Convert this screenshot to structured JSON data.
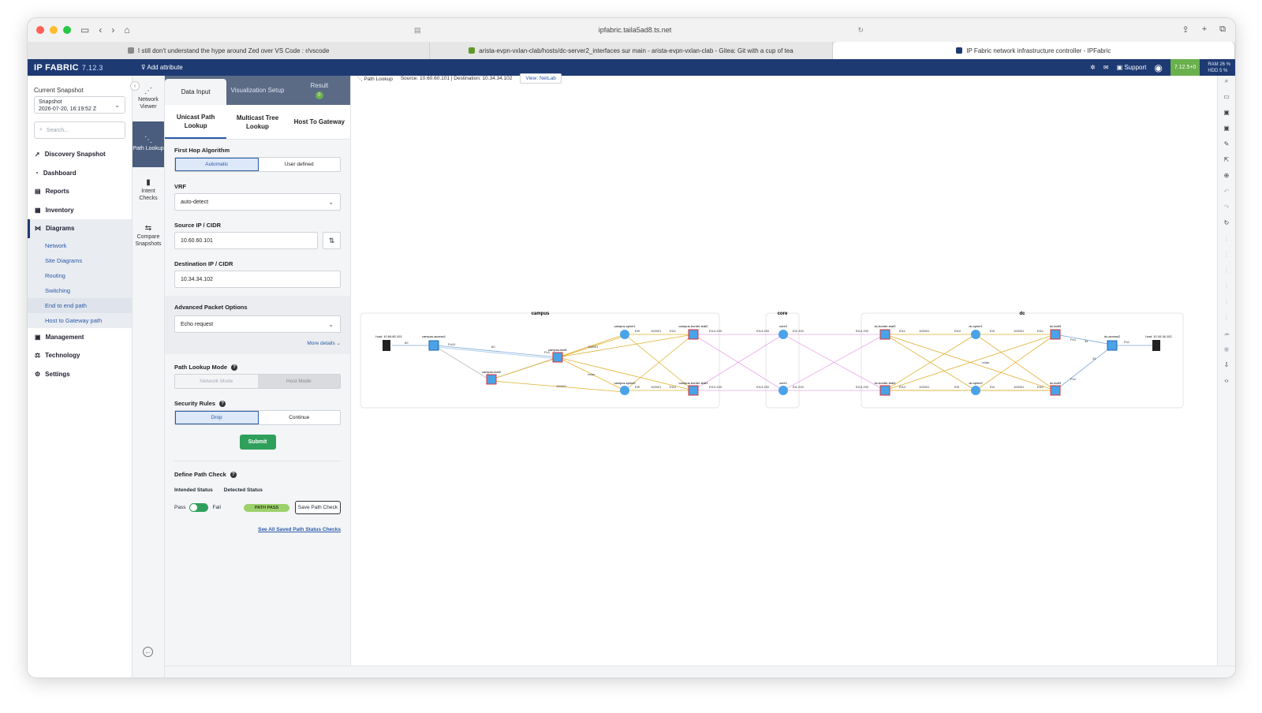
{
  "browser": {
    "url": "ipfabric.taila5ad8.ts.net",
    "tabs": [
      {
        "label": "I still don't understand the hype around Zed over VS Code : r/vscode",
        "fav_color": "#8a8a8a",
        "active": false
      },
      {
        "label": "arista-evpn-vxlan-clab/hosts/dc-server2_interfaces sur main - arista-evpn-vxlan-clab - Gitea: Git with a cup of tea",
        "fav_color": "#609926",
        "active": false
      },
      {
        "label": "IP Fabric network infrastructure controller - IPFabric",
        "fav_color": "#1d3a73",
        "active": true
      }
    ]
  },
  "header": {
    "logo": "IP FABRIC",
    "version": "7.12.3",
    "add_attribute": "Add attribute",
    "support": "Support",
    "version_badge": "7.12.5+0",
    "ram": "RAM 26 %",
    "hdd": "HDD 5 %"
  },
  "leftnav": {
    "snapshot_label": "Current Snapshot",
    "snapshot_name": "Snapshot",
    "snapshot_date": "2026-07-20, 16:19:52 Z",
    "search_placeholder": "Search...",
    "items": [
      {
        "label": "Discovery Snapshot",
        "icon": "rocket-icon"
      },
      {
        "label": "Dashboard",
        "icon": "dashboard-icon"
      },
      {
        "label": "Reports",
        "icon": "report-icon"
      },
      {
        "label": "Inventory",
        "icon": "inventory-icon"
      },
      {
        "label": "Diagrams",
        "icon": "diagram-icon"
      }
    ],
    "diagram_subs": [
      "Network",
      "Site Diagrams",
      "Routing",
      "Switching",
      "End to end path",
      "Host to Gateway path"
    ],
    "items_bottom": [
      {
        "label": "Management",
        "icon": "management-icon"
      },
      {
        "label": "Technology",
        "icon": "technology-icon"
      },
      {
        "label": "Settings",
        "icon": "settings-icon"
      }
    ]
  },
  "rail": {
    "network_viewer": "Network Viewer",
    "path_lookup": "Path Lookup",
    "intent_checks": "Intent Checks",
    "compare_snapshots": "Compare Snapshots"
  },
  "panel": {
    "tabs": [
      "Data Input",
      "Visualization Setup",
      "Result"
    ],
    "result_count": "0",
    "subtabs": [
      "Unicast Path Lookup",
      "Multicast Tree Lookup",
      "Host To Gateway"
    ],
    "first_hop_label": "First Hop Algorithm",
    "first_hop_options": [
      "Automatic",
      "User defined"
    ],
    "vrf_label": "VRF",
    "vrf_value": "auto-detect",
    "source_label": "Source IP / CIDR",
    "source_value": "10.60.60.101",
    "dest_label": "Destination IP / CIDR",
    "dest_value": "10.34.34.102",
    "adv_label": "Advanced Packet Options",
    "adv_value": "Echo request",
    "more_details": "More details ⌄",
    "mode_label": "Path Lookup Mode",
    "mode_options": [
      "Network Mode",
      "Host Mode"
    ],
    "security_label": "Security Rules",
    "security_options": [
      "Drop",
      "Continue"
    ],
    "submit": "Submit",
    "define_check": "Define Path Check",
    "intended_status": "Intended Status",
    "detected_status": "Detected Status",
    "pass": "Pass",
    "fail": "Fail",
    "path_pass": "PATH PASS",
    "save_check": "Save Path Check",
    "see_all": "See All Saved Path Status Checks"
  },
  "canvas": {
    "crumb_title": "Path Lookup",
    "crumb_info": "Source: 10.60.60.101 | Destination: 10.34.34.102",
    "crumb_view": "View: NetLab",
    "groups": [
      "campus",
      "core",
      "dc"
    ],
    "nodes": {
      "host_src": "host: 10.60.60.101",
      "campus_access1": "campus-access1",
      "campus_leaf1": "campus-leaf1",
      "campus_leaf2": "campus-leaf2",
      "campus_spine1": "campus-spine1",
      "campus_spine2": "campus-spine2",
      "campus_border_leaf2": "campus-border-leaf2",
      "campus_border_leaf1": "campus-border-leaf1",
      "core2": "core2",
      "core1": "core1",
      "dc_border_leaf2": "dc-border-leaf2",
      "dc_border_leaf1": "dc-border-leaf1",
      "dc_spine1": "dc-spine1",
      "dc_spine2": "dc-spine2",
      "dc_leaf3": "dc-leaf3",
      "dc_leaf4": "dc-leaf4",
      "dc_access2": "dc-access2",
      "host_dst": "host: 10.34.34.102"
    },
    "link_labels": {
      "e14_200": "Et14.200",
      "e13_200": "Et13.200",
      "e11": "Et11",
      "e12": "Et12",
      "e1_200": "Et1.200",
      "e2_200": "Et2.200",
      "vxlan": "vxlan",
      "v100001": "100001",
      "po1": "Po1",
      "po12": "Po12",
      "po10": "Po10",
      "e34": "34",
      "e60": "60",
      "e4": "Et4",
      "e3": "Et3",
      "e9": "Et9",
      "e10": "Et10"
    }
  }
}
